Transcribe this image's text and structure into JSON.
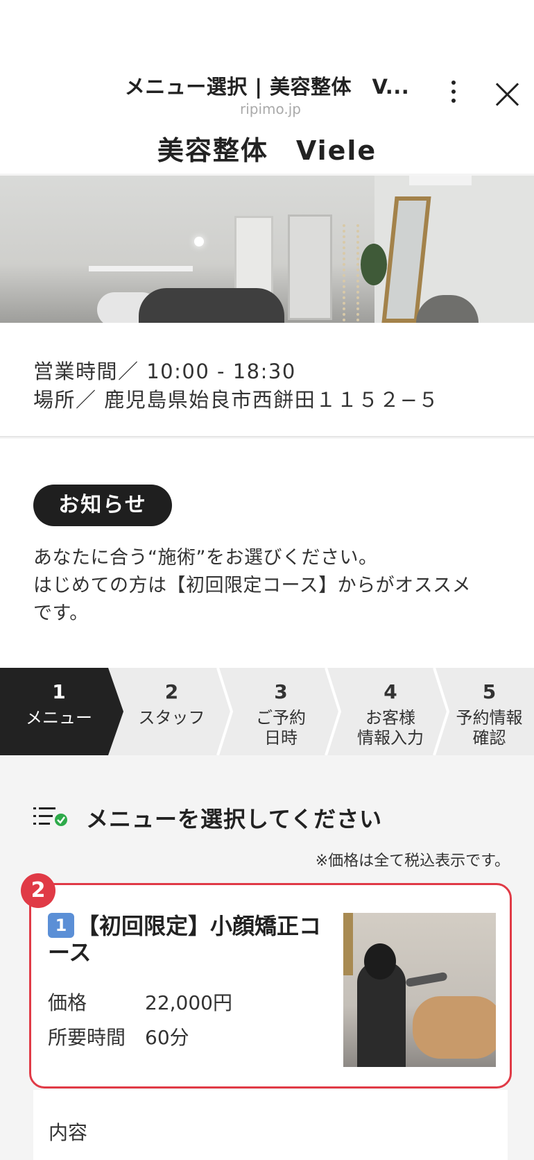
{
  "browser": {
    "title": "メニュー選択 | 美容整体　V...",
    "url": "ripimo.jp"
  },
  "shop": {
    "name": "美容整体　Viele"
  },
  "info": {
    "hours": "営業時間／ 10:00 - 18:30",
    "location": "場所／ 鹿児島県始良市西餅田１１５２−５"
  },
  "notice": {
    "label": "お知らせ",
    "lines": [
      "あなたに合う“施術”をお選びください。",
      "はじめての方は【初回限定コース】からがオススメ",
      "です。"
    ]
  },
  "steps": [
    {
      "num": "1",
      "label": "メニュー",
      "active": true
    },
    {
      "num": "2",
      "label": "スタッフ",
      "active": false
    },
    {
      "num": "3",
      "label": "ご予約\n日時",
      "active": false
    },
    {
      "num": "4",
      "label": "お客様\n情報入力",
      "active": false
    },
    {
      "num": "5",
      "label": "予約情報\n確認",
      "active": false
    }
  ],
  "menu": {
    "heading": "メニューを選択してください",
    "tax_note": "※価格は全て税込表示です。",
    "items": [
      {
        "badge": "2",
        "keycap": "1",
        "title": "【初回限定】小顔矯正コース",
        "price_label": "価格",
        "price": "22,000円",
        "duration_label": "所要時間",
        "duration": "60分"
      }
    ],
    "content_label": "内容"
  },
  "colors": {
    "accent_red": "#e03a46",
    "dark": "#222222",
    "keycap_blue": "#5b8fd6"
  }
}
